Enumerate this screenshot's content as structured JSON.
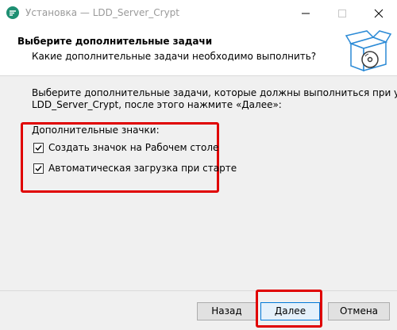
{
  "window": {
    "title": "Установка — LDD_Server_Crypt"
  },
  "header": {
    "title": "Выберите дополнительные задачи",
    "subtitle": "Какие дополнительные задачи необходимо выполнить?"
  },
  "body": {
    "description_line1": "Выберите дополнительные задачи, которые должны выполниться при установке",
    "description_line2": "LDD_Server_Crypt, после этого нажмите «Далее»:",
    "group_label": "Дополнительные значки:",
    "options": [
      {
        "label": "Создать значок на Рабочем столе",
        "checked": true
      },
      {
        "label": "Автоматическая загрузка при старте",
        "checked": true
      }
    ]
  },
  "buttons": {
    "back": "Назад",
    "next": "Далее",
    "cancel": "Отмена"
  },
  "colors": {
    "highlight": "#e00000",
    "app_icon": "#1e8f72",
    "accent": "#0078d7"
  }
}
